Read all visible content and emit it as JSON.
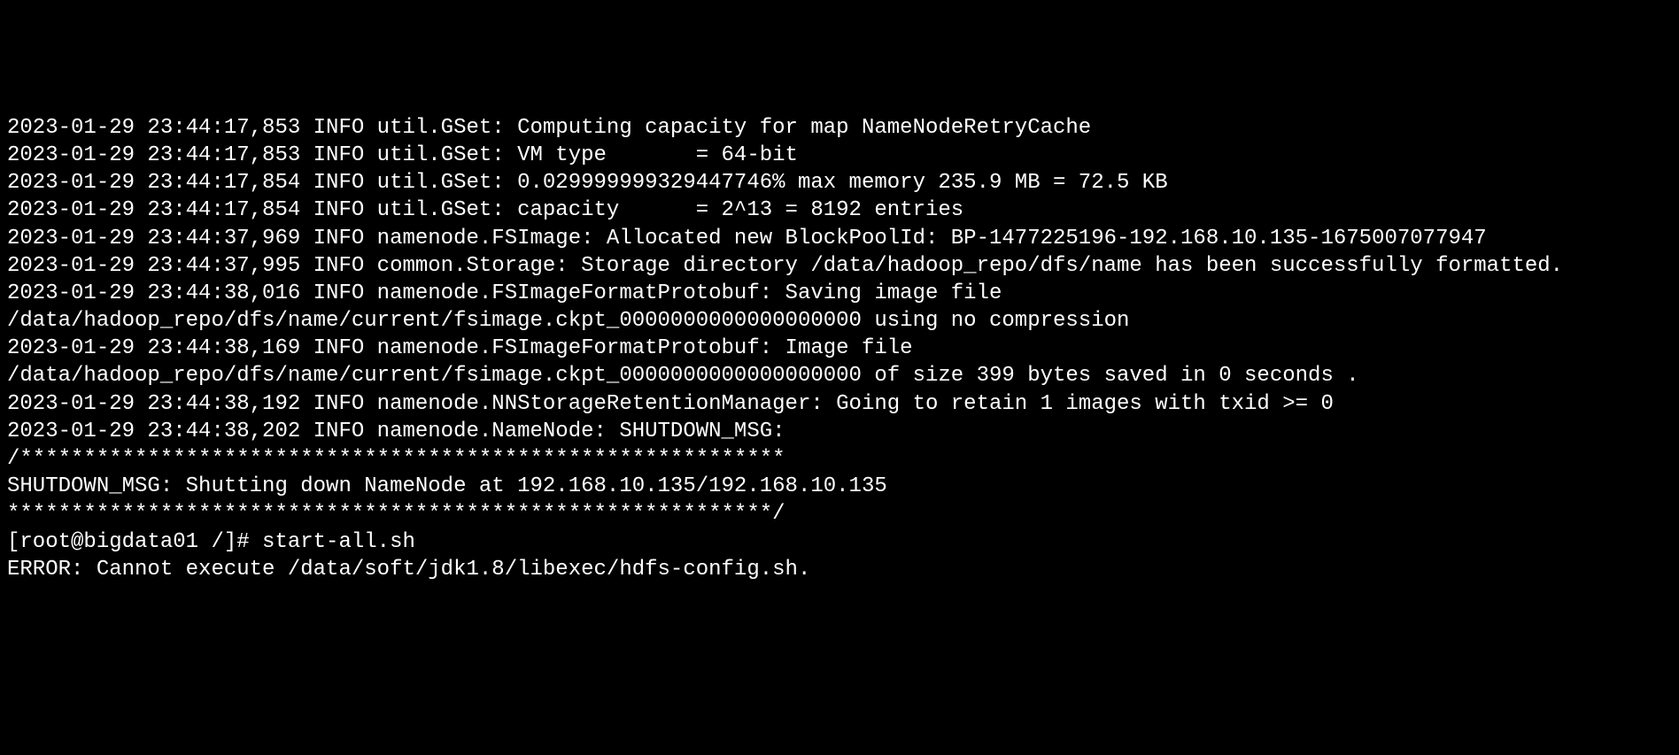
{
  "terminal": {
    "lines": [
      "2023-01-29 23:44:17,853 INFO util.GSet: Computing capacity for map NameNodeRetryCache",
      "2023-01-29 23:44:17,853 INFO util.GSet: VM type       = 64-bit",
      "2023-01-29 23:44:17,854 INFO util.GSet: 0.029999999329447746% max memory 235.9 MB = 72.5 KB",
      "2023-01-29 23:44:17,854 INFO util.GSet: capacity      = 2^13 = 8192 entries",
      "2023-01-29 23:44:37,969 INFO namenode.FSImage: Allocated new BlockPoolId: BP-1477225196-192.168.10.135-1675007077947",
      "2023-01-29 23:44:37,995 INFO common.Storage: Storage directory /data/hadoop_repo/dfs/name has been successfully formatted.",
      "2023-01-29 23:44:38,016 INFO namenode.FSImageFormatProtobuf: Saving image file /data/hadoop_repo/dfs/name/current/fsimage.ckpt_0000000000000000000 using no compression",
      "2023-01-29 23:44:38,169 INFO namenode.FSImageFormatProtobuf: Image file /data/hadoop_repo/dfs/name/current/fsimage.ckpt_0000000000000000000 of size 399 bytes saved in 0 seconds .",
      "2023-01-29 23:44:38,192 INFO namenode.NNStorageRetentionManager: Going to retain 1 images with txid >= 0",
      "2023-01-29 23:44:38,202 INFO namenode.NameNode: SHUTDOWN_MSG: ",
      "/************************************************************",
      "SHUTDOWN_MSG: Shutting down NameNode at 192.168.10.135/192.168.10.135",
      "************************************************************/"
    ],
    "prompt": "[root@bigdata01 /]# ",
    "command": "start-all.sh",
    "error_lines": [
      "ERROR: Cannot execute /data/soft/jdk1.8/libexec/hdfs-config.sh."
    ]
  }
}
